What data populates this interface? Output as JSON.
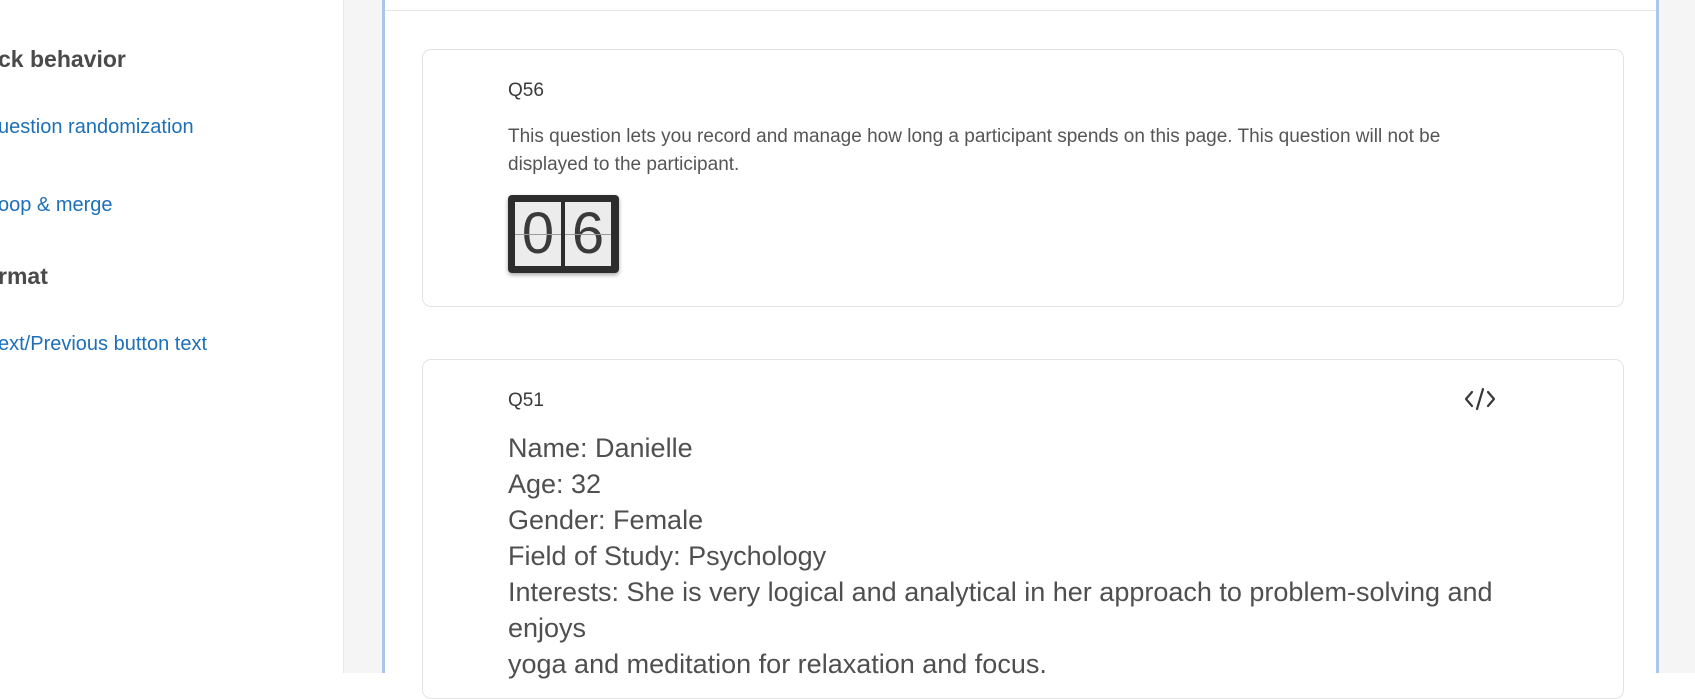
{
  "sidebar": {
    "block_behavior_heading": "ck behavior",
    "question_randomization_link": "uestion randomization",
    "loop_merge_link": "oop & merge",
    "format_heading": "rmat",
    "next_previous_link": "ext/Previous button text"
  },
  "questions": [
    {
      "id": "Q56",
      "description": "This question lets you record and manage how long a participant spends on this page. This question will not be displayed to the participant.",
      "timer_digits": [
        "0",
        "6"
      ]
    },
    {
      "id": "Q51",
      "code_icon": "code-icon",
      "lines": [
        "Name: Danielle",
        "Age: 32",
        "Gender: Female",
        "Field of Study: Psychology",
        "Interests: She is very logical and analytical in her approach to problem-solving and enjoys",
        "yoga and meditation for relaxation and focus."
      ]
    }
  ],
  "colors": {
    "link": "#1d6fb8",
    "block_border": "#a9c7ea",
    "timer_bg": "#2d2d2d"
  }
}
